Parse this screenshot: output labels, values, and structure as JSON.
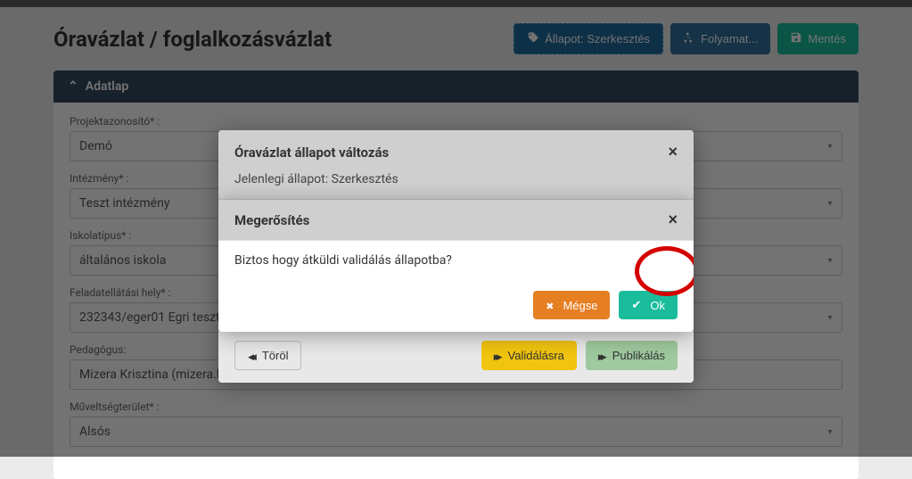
{
  "header": {
    "title": "Óravázlat / foglalkozásvázlat",
    "status_prefix": "Állapot:",
    "status_value": "Szerkesztés",
    "process_label": "Folyamat...",
    "save_label": "Mentés"
  },
  "panel": {
    "title": "Adatlap"
  },
  "fields": {
    "project_id": {
      "label": "Projektazonosító* :",
      "value": "Demó"
    },
    "institution": {
      "label": "Intézmény* :",
      "value": "Teszt intézmény"
    },
    "school_type": {
      "label": "Iskolatípus* :",
      "value": "általános iskola"
    },
    "location": {
      "label": "Feladatellátási hely* :",
      "value": "232343/eger01 Egri teszt t"
    },
    "teacher": {
      "label": "Pedagógus:",
      "value": "Mizera Krisztina (mizera.krisztina)"
    },
    "literacy": {
      "label": "Műveltségterület* :",
      "value": "Alsós"
    }
  },
  "modal_back": {
    "title": "Óravázlat állapot változás",
    "subtitle": "Jelenlegi állapot: Szerkesztés",
    "undo_label": "Töröl",
    "validate_label": "Validálásra",
    "publish_label": "Publikálás"
  },
  "modal_front": {
    "title": "Megerősítés",
    "body": "Biztos hogy átküldi validálás állapotba?",
    "cancel_label": "Mégse",
    "ok_label": "Ok"
  }
}
